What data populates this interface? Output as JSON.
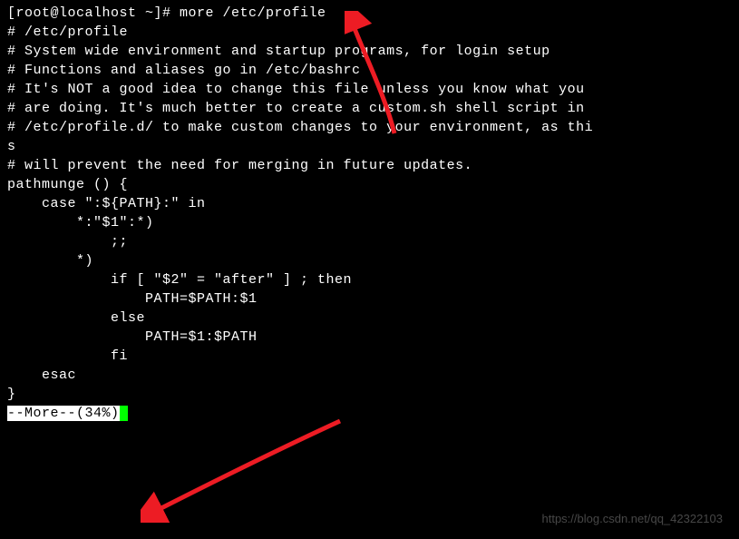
{
  "terminal": {
    "prompt": "[root@localhost ~]# ",
    "command": "more /etc/profile",
    "lines": [
      "# /etc/profile",
      "",
      "# System wide environment and startup programs, for login setup",
      "# Functions and aliases go in /etc/bashrc",
      "",
      "# It's NOT a good idea to change this file unless you know what you",
      "# are doing. It's much better to create a custom.sh shell script in",
      "# /etc/profile.d/ to make custom changes to your environment, as thi",
      "s",
      "# will prevent the need for merging in future updates.",
      "",
      "pathmunge () {",
      "    case \":${PATH}:\" in",
      "        *:\"$1\":*)",
      "            ;;",
      "        *)",
      "            if [ \"$2\" = \"after\" ] ; then",
      "                PATH=$PATH:$1",
      "            else",
      "                PATH=$1:$PATH",
      "            fi",
      "    esac",
      "}"
    ],
    "status": "--More--(34%)"
  },
  "watermark": "https://blog.csdn.net/qq_42322103"
}
